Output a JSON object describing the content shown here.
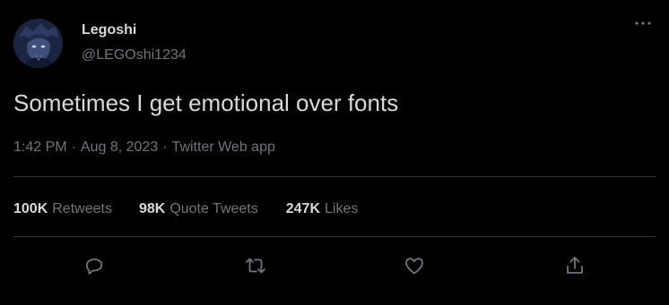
{
  "tweet": {
    "author": {
      "display_name": "Legoshi",
      "handle": "@LEGOshi1234"
    },
    "text": "Sometimes I get emotional over fonts",
    "meta": {
      "time": "1:42 PM",
      "separator": "·",
      "date": "Aug 8, 2023",
      "source": "Twitter Web app"
    },
    "stats": [
      {
        "count": "100K",
        "label": "Retweets"
      },
      {
        "count": "98K",
        "label": "Quote Tweets"
      },
      {
        "count": "247K",
        "label": "Likes"
      }
    ],
    "actions": [
      "reply-icon",
      "retweet-icon",
      "like-icon",
      "share-icon"
    ]
  },
  "colors": {
    "background": "#000000",
    "primary_text": "#d9d9d9",
    "secondary_text": "#6e767d",
    "divider": "#2f3336"
  }
}
